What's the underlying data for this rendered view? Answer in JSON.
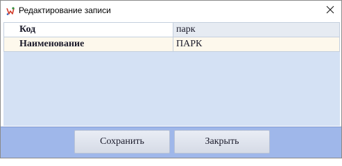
{
  "window": {
    "title": "Редактирование записи"
  },
  "fields": [
    {
      "label": "Код",
      "value": "парк"
    },
    {
      "label": "Наименование",
      "value": "ПАРК"
    }
  ],
  "buttons": {
    "save_label": "Сохранить",
    "close_label": "Закрыть"
  },
  "colors": {
    "content_background": "#d4e1f4",
    "footer_background": "#9fb7ea",
    "button_face": "#dfe4ee"
  },
  "icons": {
    "app": "app-icon",
    "close": "close-icon"
  }
}
